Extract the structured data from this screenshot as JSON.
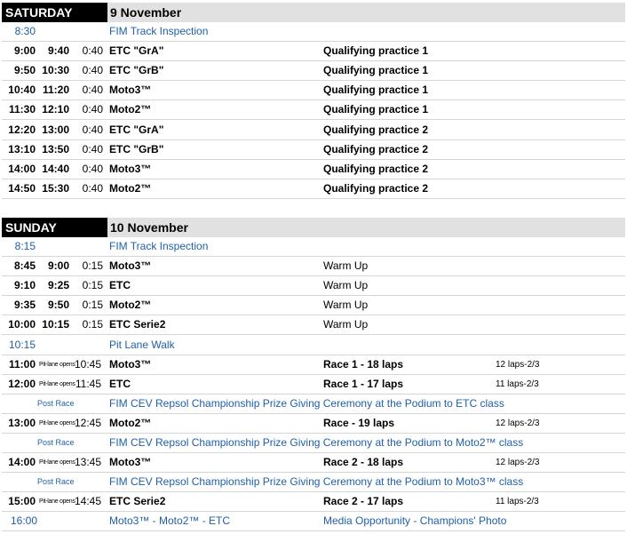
{
  "sections": [
    {
      "day": "SATURDAY",
      "date": "9 November",
      "rows": [
        {
          "type": "info",
          "start": "8:30",
          "event": "FIM Track Inspection"
        },
        {
          "type": "session",
          "start": "9:00",
          "end": "9:40",
          "duration": "0:40",
          "class": "ETC \"GrA\"",
          "session": "Qualifying practice 1"
        },
        {
          "type": "session",
          "start": "9:50",
          "end": "10:30",
          "duration": "0:40",
          "class": "ETC \"GrB\"",
          "session": "Qualifying practice 1"
        },
        {
          "type": "session",
          "start": "10:40",
          "end": "11:20",
          "duration": "0:40",
          "class": "Moto3™",
          "session": "Qualifying practice 1"
        },
        {
          "type": "session",
          "start": "11:30",
          "end": "12:10",
          "duration": "0:40",
          "class": "Moto2™",
          "session": "Qualifying practice 1"
        },
        {
          "type": "session",
          "start": "12:20",
          "end": "13:00",
          "duration": "0:40",
          "class": "ETC \"GrA\"",
          "session": "Qualifying practice 2"
        },
        {
          "type": "session",
          "start": "13:10",
          "end": "13:50",
          "duration": "0:40",
          "class": "ETC \"GrB\"",
          "session": "Qualifying practice 2"
        },
        {
          "type": "session",
          "start": "14:00",
          "end": "14:40",
          "duration": "0:40",
          "class": "Moto3™",
          "session": "Qualifying practice 2"
        },
        {
          "type": "session",
          "start": "14:50",
          "end": "15:30",
          "duration": "0:40",
          "class": "Moto2™",
          "session": "Qualifying practice 2"
        }
      ]
    },
    {
      "day": "SUNDAY",
      "date": "10 November",
      "rows": [
        {
          "type": "info",
          "start": "8:15",
          "event": "FIM Track Inspection"
        },
        {
          "type": "warm",
          "start": "8:45",
          "end": "9:00",
          "duration": "0:15",
          "class": "Moto3™",
          "session": "Warm Up"
        },
        {
          "type": "warm",
          "start": "9:10",
          "end": "9:25",
          "duration": "0:15",
          "class": "ETC",
          "session": "Warm Up"
        },
        {
          "type": "warm",
          "start": "9:35",
          "end": "9:50",
          "duration": "0:15",
          "class": "Moto2™",
          "session": "Warm Up"
        },
        {
          "type": "warm",
          "start": "10:00",
          "end": "10:15",
          "duration": "0:15",
          "class": "ETC Serie2",
          "session": "Warm Up"
        },
        {
          "type": "info",
          "start": "10:15",
          "event": "Pit Lane Walk"
        },
        {
          "type": "race",
          "start": "11:00",
          "pit": "Pit-lane opens",
          "pit_time": "10:45",
          "class": "Moto3™",
          "session": "Race 1 - 18 laps",
          "laps": "12 laps-2/3"
        },
        {
          "type": "race",
          "start": "12:00",
          "pit": "Pit-lane opens",
          "pit_time": "11:45",
          "class": "ETC",
          "session": "Race 1 - 17 laps",
          "laps": "11 laps-2/3"
        },
        {
          "type": "postrace",
          "label": "Post Race",
          "event": "FIM CEV Repsol Championship Prize Giving Ceremony at the Podium to ETC class"
        },
        {
          "type": "race",
          "start": "13:00",
          "pit": "Pit-lane opens",
          "pit_time": "12:45",
          "class": "Moto2™",
          "session": "Race - 19 laps",
          "laps": "12 laps-2/3"
        },
        {
          "type": "postrace",
          "label": "Post Race",
          "event": "FIM CEV Repsol Championship Prize Giving Ceremony at the Podium to Moto2™ class"
        },
        {
          "type": "race",
          "start": "14:00",
          "pit": "Pit-lane opens",
          "pit_time": "13:45",
          "class": "Moto3™",
          "session": "Race 2 - 18 laps",
          "laps": "12 laps-2/3"
        },
        {
          "type": "postrace",
          "label": "Post Race",
          "event": "FIM CEV Repsol Championship Prize Giving Ceremony at the Podium to Moto3™ class"
        },
        {
          "type": "race",
          "start": "15:00",
          "pit": "Pit-lane opens",
          "pit_time": "14:45",
          "class": "ETC Serie2",
          "session": "Race 2 - 17 laps",
          "laps": "11 laps-2/3"
        },
        {
          "type": "media",
          "start": "16:00",
          "event": "Moto3™ - Moto2™ - ETC",
          "session": "Media Opportunity - Champions' Photo"
        }
      ]
    }
  ]
}
